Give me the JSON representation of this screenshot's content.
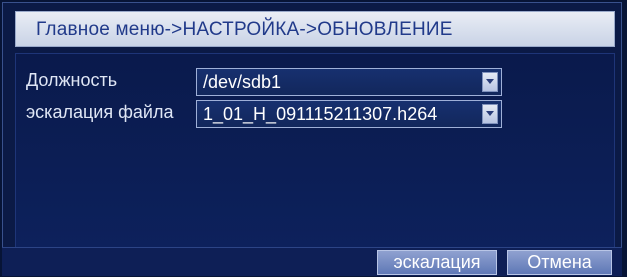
{
  "window": {
    "title": "Главное меню->НАСТРОЙКА->ОБНОВЛЕНИЕ"
  },
  "form": {
    "device": {
      "label": "Должность",
      "value": "/dev/sdb1"
    },
    "file": {
      "label": "эскалация файла",
      "value": "1_01_H_091115211307.h264"
    }
  },
  "buttons": {
    "upgrade_label": "эскалация",
    "cancel_label": "Отмена"
  },
  "colors": {
    "background": "#0b1a46",
    "title_text": "#213a8a",
    "button": "#6f86c0"
  },
  "icons": {
    "dropdown": "chevron-down-icon"
  }
}
